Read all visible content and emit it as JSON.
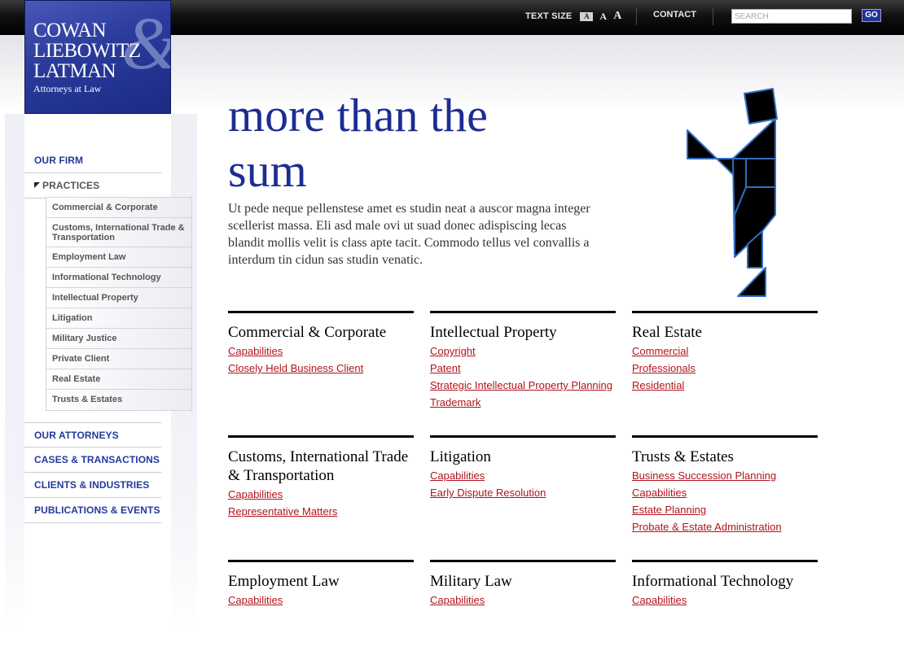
{
  "header": {
    "text_size_label": "TEXT SIZE",
    "text_size_small": "A",
    "text_size_medium": "A",
    "text_size_large": "A",
    "contact": "CONTACT",
    "search_placeholder": "SEARCH",
    "go": "GO"
  },
  "logo": {
    "line1": "COWAN",
    "line2": "LIEBOWITZ",
    "line3": "LATMAN",
    "ampersand": "&",
    "subtitle": "Attorneys at Law"
  },
  "sidebar": {
    "items": [
      {
        "label": "OUR FIRM"
      },
      {
        "label": "PRACTICES"
      },
      {
        "label": "OUR ATTORNEYS"
      },
      {
        "label": "CASES & TRANSACTIONS"
      },
      {
        "label": "CLIENTS & INDUSTRIES"
      },
      {
        "label": "PUBLICATIONS & EVENTS"
      }
    ],
    "practices": [
      "Commercial & Corporate",
      "Customs, International Trade & Transportation",
      "Employment Law",
      "Informational Technology",
      "Intellectual Property",
      "Litigation",
      "Military Justice",
      "Private Client",
      "Real Estate",
      "Trusts & Estates"
    ]
  },
  "hero": {
    "title": "more than the sum",
    "text": "Ut pede neque pellenstese amet es studin neat a auscor magna integer scellerist massa. Eli asd male ovi ut suad donec adispiscing lecas blandit mollis velit is class apte tacit. Commodo tellus vel convallis a interdum tin cidun sas studin venatic."
  },
  "colors": {
    "brand_blue": "#1c2d93",
    "link_red": "#b0141c",
    "tangram_outline": "#2f6ec4"
  },
  "practice_areas": [
    {
      "title": "Commercial & Corporate",
      "links": [
        "Capabilities",
        "Closely Held Business Client"
      ]
    },
    {
      "title": "Intellectual Property",
      "links": [
        "Copyright",
        "Patent",
        "Strategic Intellectual Property Planning",
        "Trademark"
      ]
    },
    {
      "title": "Real Estate",
      "links": [
        "Commercial",
        "Professionals",
        "Residential"
      ]
    },
    {
      "title": "Customs, International Trade & Transportation",
      "links": [
        "Capabilities",
        "Representative Matters"
      ]
    },
    {
      "title": "Litigation",
      "links": [
        "Capabilities",
        "Early Dispute Resolution"
      ]
    },
    {
      "title": "Trusts & Estates",
      "links": [
        "Business Succession Planning",
        "Capabilities",
        "Estate Planning",
        "Probate & Estate Administration"
      ]
    },
    {
      "title": "Employment Law",
      "links": [
        "Capabilities"
      ]
    },
    {
      "title": "Military Law",
      "links": [
        "Capabilities"
      ]
    },
    {
      "title": "Informational Technology",
      "links": [
        "Capabilities"
      ]
    }
  ]
}
